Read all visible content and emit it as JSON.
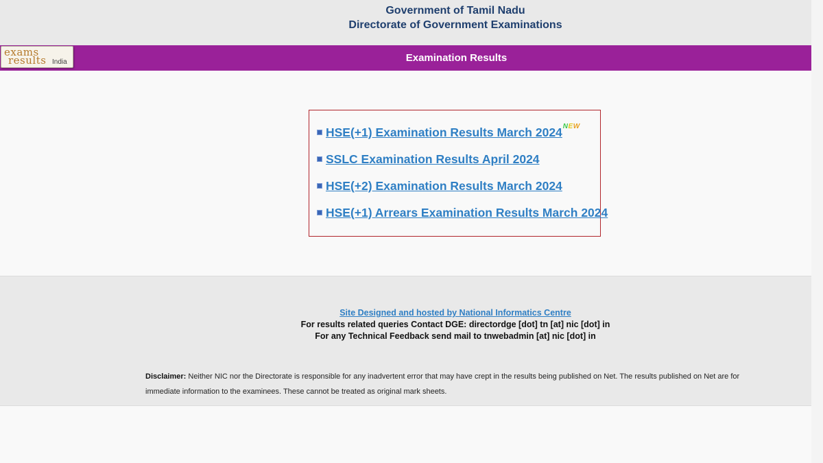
{
  "header": {
    "line1": "Government of Tamil Nadu",
    "line2": "Directorate of Government Examinations"
  },
  "results_bar": {
    "logo_exams": "exams",
    "logo_results": "results",
    "logo_india": "India",
    "title": "Examination Results"
  },
  "links": [
    {
      "label": "HSE(+1) Examination Results March 2024",
      "new": true
    },
    {
      "label": "SSLC Examination Results April 2024",
      "new": false
    },
    {
      "label": "HSE(+2) Examination Results March 2024",
      "new": false
    },
    {
      "label": "HSE(+1) Arrears Examination Results March 2024",
      "new": false
    }
  ],
  "new_badge": "NEW",
  "footer": {
    "nic_link": "Site Designed and hosted by National Informatics Centre",
    "contact": "For results related queries Contact DGE:  directordge [dot] tn [at] nic [dot] in",
    "feedback": "For any Technical Feedback send mail to tnwebadmin [at] nic [dot] in",
    "disclaimer_label": "Disclaimer:",
    "disclaimer_text": " Neither NIC nor the Directorate is responsible for any inadvertent error that may have crept in the results being published on Net. The results published on Net are for immediate information to the examinees. These cannot be treated as original mark sheets."
  },
  "colors": {
    "header_text": "#1f3f6e",
    "bar": "#9a2199",
    "link": "#2f7fc4",
    "box_border": "#b0242a"
  }
}
